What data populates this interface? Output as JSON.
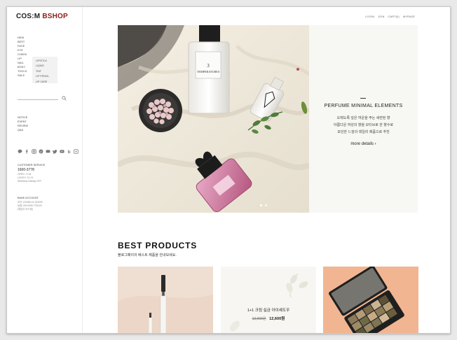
{
  "brand": {
    "part1": "COS:M",
    "part2": "BSHOP"
  },
  "top_links": [
    "LOGIN",
    "JOIN",
    "CART(0)",
    "MYPAGE"
  ],
  "menu": [
    "NEW",
    "BEST",
    "FACE",
    "EYE",
    "CHEEK",
    "LIP",
    "NAIL",
    "BODY",
    "TOOLS",
    "SALE"
  ],
  "submenu": [
    "LIPSTICK",
    "LIQUID",
    "TINT",
    "LIP PENCIL",
    "LIP CARE"
  ],
  "board": [
    "NOTICE",
    "EVENT",
    "REVIEW",
    "Q&A"
  ],
  "social_icons": [
    "chat-icon",
    "facebook-icon",
    "instagram-icon",
    "pinterest-icon",
    "talk-icon",
    "twitter-icon",
    "youtube-icon",
    "blog-icon",
    "play-icon"
  ],
  "customer_service": {
    "title": "CUSTOMER SERVICE",
    "phone": "1600-3778",
    "open": "OPEN : 9-18",
    "lunch": "LUNCH: 12-13",
    "holiday": "Weekend,Holiday OFF"
  },
  "bank": {
    "title": "BANK ACCOUNT",
    "line1": "우리 123456-01-203050",
    "line2": "농협 135-5005-7705-81",
    "line3": "(예금주:코스엠)"
  },
  "hero": {
    "title": "PERFUME MINIMAL ELEMENTS",
    "desc1": "오래도록 깊은 여운을 주는 세련된 향",
    "desc2": "아름다운 여성의 향을 모티브로 한 향수로",
    "desc3": "모던한 느낌의 데일리 제품으로 추천",
    "more": "more details",
    "bottle_label": "3 TEMPERATURES",
    "slide_count": 2,
    "active_slide": 1
  },
  "best": {
    "title": "BEST PRODUCTS",
    "subtitle": "블로그페이의 베스트 제품을 안내보세요.",
    "product2_name": "1+1 크림 실금 아이섀도우",
    "product2_old_price": "12,600원",
    "product2_price": "12,600원"
  },
  "colors": {
    "brand_red": "#8b1d1d",
    "text": "#222222",
    "panel": "#f7f7f4"
  }
}
